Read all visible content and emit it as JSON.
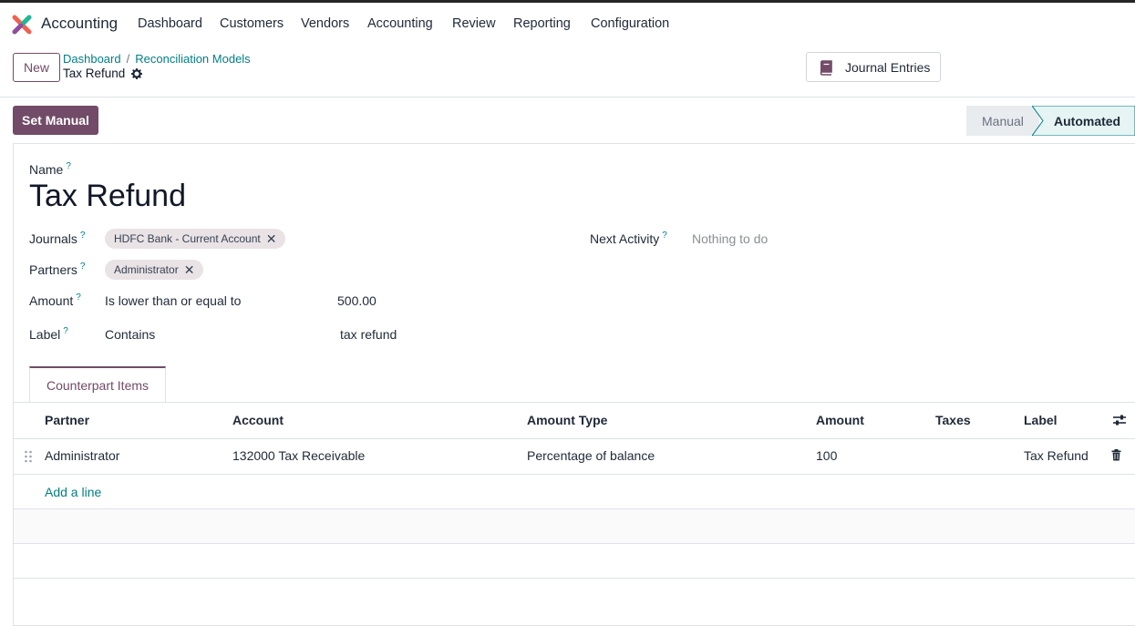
{
  "navbar": {
    "app_name": "Accounting",
    "menu": [
      "Dashboard",
      "Customers",
      "Vendors",
      "Accounting",
      "Review",
      "Reporting",
      "Configuration"
    ]
  },
  "control_panel": {
    "new_label": "New",
    "breadcrumb": [
      "Dashboard",
      "Reconciliation Models"
    ],
    "breadcrumb_sep": "/",
    "current": "Tax Refund",
    "journal_entries_label": "Journal Entries"
  },
  "statusbar": {
    "set_manual_label": "Set Manual",
    "stages": [
      "Manual",
      "Automated"
    ],
    "active_stage": "Automated"
  },
  "form": {
    "name_label": "Name",
    "help_mark": "?",
    "name_value": "Tax Refund",
    "journals_label": "Journals",
    "journals_tags": [
      "HDFC Bank - Current Account"
    ],
    "partners_label": "Partners",
    "partners_tags": [
      "Administrator"
    ],
    "amount_label": "Amount",
    "amount_condition": "Is lower than or equal to",
    "amount_value": "500.00",
    "label_label": "Label",
    "label_condition": "Contains",
    "label_value": "tax refund",
    "next_activity_label": "Next Activity",
    "next_activity_value": "Nothing to do",
    "tag_remove_glyph": "✕"
  },
  "tabs": {
    "counterpart_label": "Counterpart Items"
  },
  "table": {
    "headers": [
      "Partner",
      "Account",
      "Amount Type",
      "Amount",
      "Taxes",
      "Label"
    ],
    "rows": [
      [
        "Administrator",
        "132000 Tax Receivable",
        "Percentage of balance",
        "100",
        "",
        "Tax Refund"
      ]
    ],
    "add_line_label": "Add a line"
  },
  "colors": {
    "brand": "#714b67",
    "link": "#017e84"
  }
}
